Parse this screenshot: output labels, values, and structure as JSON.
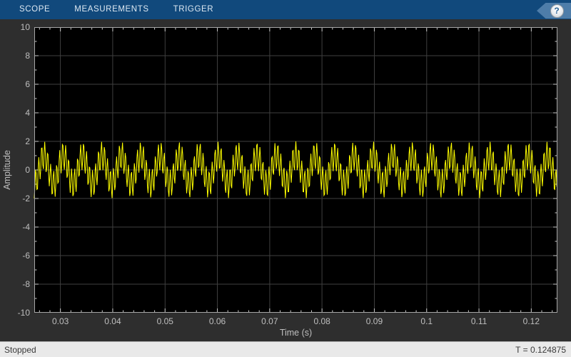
{
  "toolbar": {
    "bg_color": "#11497c",
    "tabs": [
      {
        "label": "SCOPE"
      },
      {
        "label": "MEASUREMENTS"
      },
      {
        "label": "TRIGGER"
      }
    ],
    "help_label": "?"
  },
  "status_bar": {
    "left": "Stopped",
    "right": "T = 0.124875"
  },
  "chart_data": {
    "type": "line",
    "title": "",
    "xlabel": "Time (s)",
    "ylabel": "Amplitude",
    "xlim": [
      0.025,
      0.125
    ],
    "ylim": [
      -10,
      10
    ],
    "grid": true,
    "legend": "none",
    "x_tick_values": [
      0.03,
      0.04,
      0.05,
      0.06,
      0.07,
      0.08,
      0.09,
      0.1,
      0.11,
      0.12
    ],
    "x_tick_labels": [
      "0.03",
      "0.04",
      "0.05",
      "0.06",
      "0.07",
      "0.08",
      "0.09",
      "0.1",
      "0.11",
      "0.12"
    ],
    "y_tick_values": [
      -10,
      -8,
      -6,
      -4,
      -2,
      0,
      2,
      4,
      6,
      8,
      10
    ],
    "y_tick_labels": [
      "-10",
      "-8",
      "-6",
      "-4",
      "-2",
      "0",
      "2",
      "4",
      "6",
      "8",
      "10"
    ],
    "x_minor_step": 0.002,
    "y_minor_step": 1,
    "colors": {
      "plot_bg": "#000000",
      "grid": "#3f3f3f",
      "border": "#a6a6a6",
      "tick": "#c8c8c8",
      "label": "#bfbfbf",
      "line": "#ffff00"
    },
    "signal": {
      "description": "yellow waveform: low-frequency sine plus high-frequency component, peak amplitude ~2",
      "sample_rate_hz": 8000,
      "t_start": 0.025,
      "t_end": 0.124875,
      "components": [
        {
          "type": "sine",
          "frequency_hz": 270,
          "amplitude": 1
        },
        {
          "type": "sine",
          "frequency_hz": 1750,
          "amplitude": 1
        }
      ]
    }
  }
}
